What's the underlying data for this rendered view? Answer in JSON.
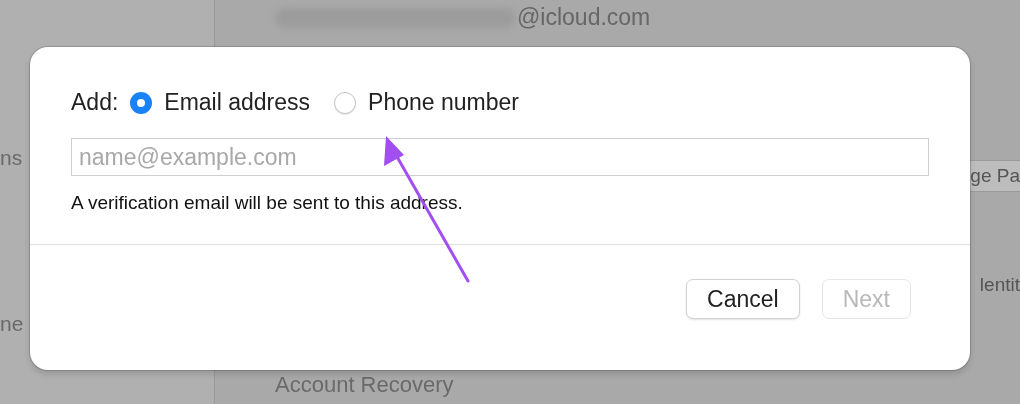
{
  "background": {
    "account_email": "@icloud.com",
    "sidebar_items": [
      "ns",
      "ne"
    ],
    "button_fragment": "ge Pa",
    "row_fragment": "lentit",
    "section_title": "Account Recovery"
  },
  "dialog": {
    "add_label": "Add:",
    "options": [
      {
        "label": "Email address",
        "selected": true
      },
      {
        "label": "Phone number",
        "selected": false
      }
    ],
    "field": {
      "placeholder": "name@example.com"
    },
    "note": "A verification email will be sent to this address.",
    "buttons": [
      {
        "label": "Cancel",
        "disabled": false
      },
      {
        "label": "Next",
        "disabled": true
      }
    ]
  }
}
